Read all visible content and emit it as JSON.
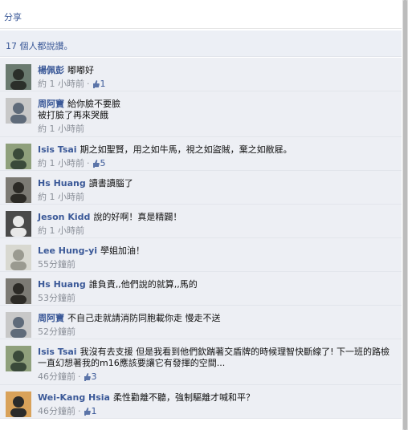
{
  "share_label": "分享",
  "likes_summary": "17 個人都說讚。",
  "comments": [
    {
      "author": "楊佩彭",
      "text": "嘟嘟好",
      "time": "約 1 小時前",
      "likes": "1",
      "avatar_bg": "#6a7a6f",
      "avatar_fg": "#2b2f2a"
    },
    {
      "author": "周阿寶",
      "text": "給你臉不要臉\n被打臉了再來哭餓",
      "time": "約 1 小時前",
      "likes": "",
      "avatar_bg": "#c8c8c8",
      "avatar_fg": "#5f6b7a"
    },
    {
      "author": "Isis Tsai",
      "text": "期之如聖賢，用之如牛馬，視之如盜賊，棄之如敝屣。",
      "time": "約 1 小時前",
      "likes": "5",
      "avatar_bg": "#8fa07c",
      "avatar_fg": "#3a4a3a"
    },
    {
      "author": "Hs Huang",
      "text": "讀書讀腦了",
      "time": "約 1 小時前",
      "likes": "",
      "avatar_bg": "#7c7a74",
      "avatar_fg": "#2c2a26"
    },
    {
      "author": "Jeson Kidd",
      "text": "說的好啊！真是精闢！",
      "time": "約 1 小時前",
      "likes": "",
      "avatar_bg": "#4a4a4a",
      "avatar_fg": "#e8e8e8"
    },
    {
      "author": "Lee Hung-yi",
      "text": "學姐加油！",
      "time": "55分鐘前",
      "likes": "",
      "avatar_bg": "#d8d8d0",
      "avatar_fg": "#9a9a90"
    },
    {
      "author": "Hs Huang",
      "text": "誰負責,,他們說的就算,,馬的",
      "time": "53分鐘前",
      "likes": "",
      "avatar_bg": "#7c7a74",
      "avatar_fg": "#2c2a26"
    },
    {
      "author": "周阿寶",
      "text": "不自己走就請消防同胞載你走 慢走不送",
      "time": "52分鐘前",
      "likes": "",
      "avatar_bg": "#c8c8c8",
      "avatar_fg": "#5f6b7a"
    },
    {
      "author": "Isis Tsai",
      "text": "我沒有去支援 但是我看到他們欽踹著交盾牌的時候理智快斷線了! 下一班的路檢一直幻想著我的m16應該要讓它有發揮的空間...",
      "time": "46分鐘前",
      "likes": "3",
      "avatar_bg": "#8fa07c",
      "avatar_fg": "#3a4a3a"
    },
    {
      "author": "Wei-Kang Hsia",
      "text": "柔性勸離不聽，強制驅離才喊和平？",
      "time": "46分鐘前",
      "likes": "1",
      "avatar_bg": "#d9a25a",
      "avatar_fg": "#2b2b2b"
    }
  ]
}
